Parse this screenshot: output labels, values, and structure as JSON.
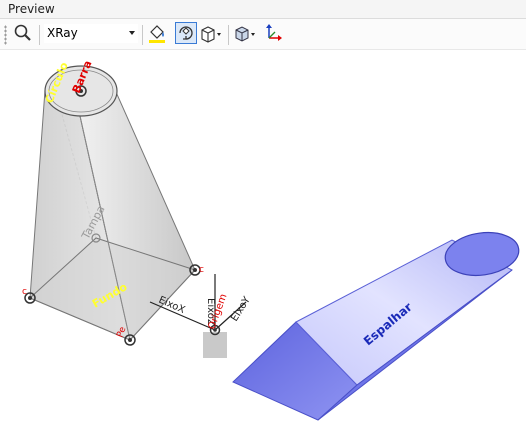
{
  "panel": {
    "title": "Preview"
  },
  "toolbar": {
    "render_mode": {
      "value": "XRay"
    },
    "icons": [
      "magnifier-icon",
      "paint-bucket-icon",
      "rotate-view-icon",
      "box-view-icon",
      "material-icon",
      "axes-icon"
    ],
    "highlight_color": "#ffe600"
  },
  "scene": {
    "pyramid": {
      "top_labels": [
        "Círculo",
        "Barra"
      ],
      "side_label": "Tampa",
      "base_label": "Fundo",
      "front_label": "Pe"
    },
    "axes": {
      "x": "EixoX",
      "y": "EixoY",
      "z": "EixoZ",
      "origin": "Origem"
    },
    "wedge": {
      "label": "Espalhar",
      "color": "#7e84ee"
    },
    "colors": {
      "red": "#e00000",
      "yellow": "#ffff30",
      "blue": "#1a2ab8",
      "gray": "#9a9a9a"
    }
  }
}
